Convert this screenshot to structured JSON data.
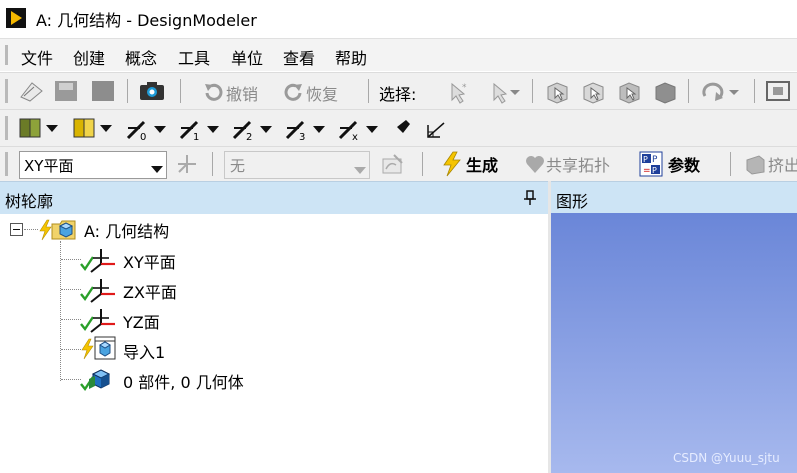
{
  "window": {
    "title": "A: 几何结构 - DesignModeler"
  },
  "menu": [
    "文件",
    "创建",
    "概念",
    "工具",
    "单位",
    "查看",
    "帮助"
  ],
  "toolbar1": {
    "undo_label": "撤销",
    "redo_label": "恢复",
    "select_label": "选择:"
  },
  "toolbar3": {
    "plane_select": "XY平面",
    "sketch_select": "无",
    "generate_label": "生成",
    "share_topology_label": "共享拓扑",
    "parameters_label": "参数",
    "extrude_label": "挤出"
  },
  "tree": {
    "header": "树轮廓",
    "pin": "ᵻ",
    "root": "A: 几何结构",
    "items": [
      {
        "label": "XY平面",
        "icon": "plane-icon"
      },
      {
        "label": "ZX平面",
        "icon": "plane-icon"
      },
      {
        "label": "YZ面",
        "icon": "plane-icon"
      },
      {
        "label": "导入1",
        "icon": "import-icon"
      },
      {
        "label": "0 部件, 0 几何体",
        "icon": "parts-icon"
      }
    ]
  },
  "graphics": {
    "header": "图形"
  },
  "watermark": "CSDN @Yuuu_sjtu",
  "colors": {
    "panel_header": "#cde4f5",
    "graphics_top": "#6a86d8",
    "graphics_bottom": "#a7b9ee",
    "accent_yellow": "#f5c400"
  }
}
